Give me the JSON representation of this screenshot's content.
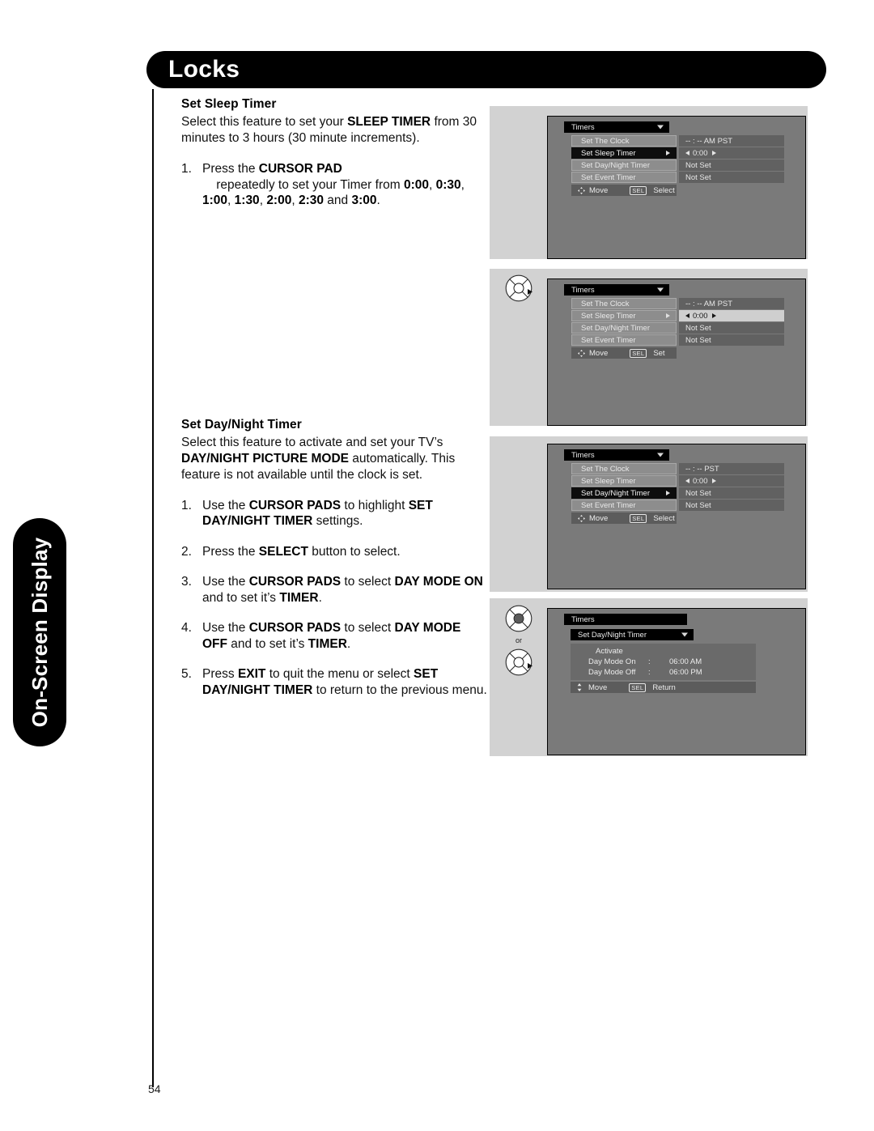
{
  "page": {
    "header_title": "Locks",
    "side_tab": "On-Screen Display",
    "page_number": "54"
  },
  "sections": [
    {
      "heading": "Set Sleep Timer",
      "intro_1": "Select this feature to set your ",
      "intro_b1": "SLEEP TIMER",
      "intro_2": " from 30 minutes to 3 hours (30 minute increments).",
      "steps": [
        {
          "num": "1.",
          "p1": "Press the ",
          "b1": "CURSOR PAD",
          "p2": "    repeatedly to set your Timer from ",
          "b2": "0:00",
          "p3": ", ",
          "b3": "0:30",
          "p4": ", ",
          "b4": "1:00",
          "p5": ", ",
          "b5": "1:30",
          "p6": ", ",
          "b6": "2:00",
          "p7": ", ",
          "b7": "2:30",
          "p8": " and ",
          "b8": "3:00",
          "p9": "."
        }
      ]
    },
    {
      "heading": "Set Day/Night Timer",
      "intro_1": "Select this feature to activate and set your TV’s ",
      "intro_b1": "DAY/NIGHT PICTURE MODE",
      "intro_2": " automatically. This feature is not available until the clock is set.",
      "steps": [
        {
          "num": "1.",
          "p1": "Use the ",
          "b1": "CURSOR PADS",
          "p2": " to highlight ",
          "b2": "SET DAY/NIGHT TIMER",
          "p3": " settings."
        },
        {
          "num": "2.",
          "p1": "Press the ",
          "b1": "SELECT",
          "p2": " button to select."
        },
        {
          "num": "3.",
          "p1": "Use the ",
          "b1": "CURSOR PADS",
          "p2": " to select ",
          "b2": "DAY MODE ON",
          "p3": " and to set it’s ",
          "b3": "TIMER",
          "p4": "."
        },
        {
          "num": "4.",
          "p1": "Use the ",
          "b1": "CURSOR PADS",
          "p2": " to select ",
          "b2": "DAY MODE OFF",
          "p3": " and to set it’s ",
          "b3": "TIMER",
          "p4": "."
        },
        {
          "num": "5.",
          "p1": "Press ",
          "b1": "EXIT",
          "p2": " to quit the menu or select ",
          "b2": "SET DAY/NIGHT TIMER",
          "p3": " to return to the previous menu."
        }
      ]
    }
  ],
  "osd_screens": [
    {
      "id": "screen1",
      "menu_title": "Timers",
      "rows": [
        {
          "label": "Set The Clock",
          "selected": false,
          "arrow": false
        },
        {
          "label": "Set Sleep Timer",
          "selected": true,
          "arrow": true
        },
        {
          "label": "Set Day/Night Timer",
          "selected": false,
          "arrow": false
        },
        {
          "label": "Set Event Timer",
          "selected": false,
          "arrow": false
        }
      ],
      "values": [
        {
          "text": "-- : --  AM PST",
          "highlight": false,
          "spinner": false
        },
        {
          "text": "0:00",
          "highlight": false,
          "spinner": true
        },
        {
          "text": "Not Set",
          "highlight": false,
          "spinner": false
        },
        {
          "text": "Not Set",
          "highlight": false,
          "spinner": false
        }
      ],
      "footer": {
        "move": "Move",
        "key": "SEL",
        "action": "Select"
      },
      "has_pad_icon": false
    },
    {
      "id": "screen2",
      "menu_title": "Timers",
      "rows": [
        {
          "label": "Set The Clock",
          "selected": false,
          "arrow": false
        },
        {
          "label": "Set Sleep Timer",
          "selected": false,
          "arrow": true
        },
        {
          "label": "Set Day/Night Timer",
          "selected": false,
          "arrow": false
        },
        {
          "label": "Set Event Timer",
          "selected": false,
          "arrow": false
        }
      ],
      "values": [
        {
          "text": "-- : --  AM PST",
          "highlight": false,
          "spinner": false
        },
        {
          "text": "0:00",
          "highlight": true,
          "spinner": true
        },
        {
          "text": "Not Set",
          "highlight": false,
          "spinner": false
        },
        {
          "text": "Not Set",
          "highlight": false,
          "spinner": false
        }
      ],
      "footer": {
        "move": "Move",
        "key": "SEL",
        "action": "Set"
      },
      "has_pad_icon": true
    },
    {
      "id": "screen3",
      "menu_title": "Timers",
      "rows": [
        {
          "label": "Set The Clock",
          "selected": false,
          "arrow": false
        },
        {
          "label": "Set Sleep Timer",
          "selected": false,
          "arrow": false
        },
        {
          "label": "Set Day/Night Timer",
          "selected": true,
          "arrow": true
        },
        {
          "label": "Set Event Timer",
          "selected": false,
          "arrow": false
        }
      ],
      "values": [
        {
          "text": "-- : --  PST",
          "highlight": false,
          "spinner": false
        },
        {
          "text": "0:00",
          "highlight": false,
          "spinner": true
        },
        {
          "text": "Not Set",
          "highlight": false,
          "spinner": false
        },
        {
          "text": "Not Set",
          "highlight": false,
          "spinner": false
        }
      ],
      "footer": {
        "move": "Move",
        "key": "SEL",
        "action": "Select"
      },
      "has_pad_icon": false
    }
  ],
  "osd_screen4": {
    "menu_title": "Timers",
    "submenu_title": "Set Day/Night Timer",
    "activate_label": "Activate",
    "entries": [
      {
        "label": "Day Mode On",
        "colon": ":",
        "value": "06:00 AM"
      },
      {
        "label": "Day Mode Off",
        "colon": ":",
        "value": "06:00 PM"
      }
    ],
    "footer": {
      "move": "Move",
      "key": "SEL",
      "action": "Return"
    },
    "or_label": "or"
  },
  "colors": {
    "panel_bg": "#7a7a7a",
    "shot_bg": "#d2d2d2",
    "row_bg": "#8d8d8d",
    "row_selected": "#0d0d0d",
    "value_bg": "#616161",
    "value_highlight": "#cfcfcf"
  }
}
